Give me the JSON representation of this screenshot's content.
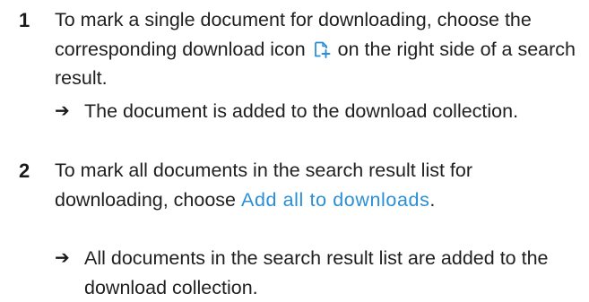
{
  "steps": [
    {
      "number": "1",
      "text_before": "To mark a single document for downloading, choose the corresponding download icon",
      "icon": "document-download-icon",
      "text_after": "on the right side of a search result.",
      "result_arrow": "➔",
      "result": "The document is added to the download collection."
    },
    {
      "number": "2",
      "text_before": "To mark all documents in the search result list for downloading, choose",
      "link": "Add all to downloads",
      "text_after": ".",
      "result_arrow": "➔",
      "result": "All documents in the search result list are added to the download collection."
    }
  ],
  "colors": {
    "link": "#2b8fd6",
    "icon": "#2b8fd6",
    "text": "#1f1f1f"
  }
}
